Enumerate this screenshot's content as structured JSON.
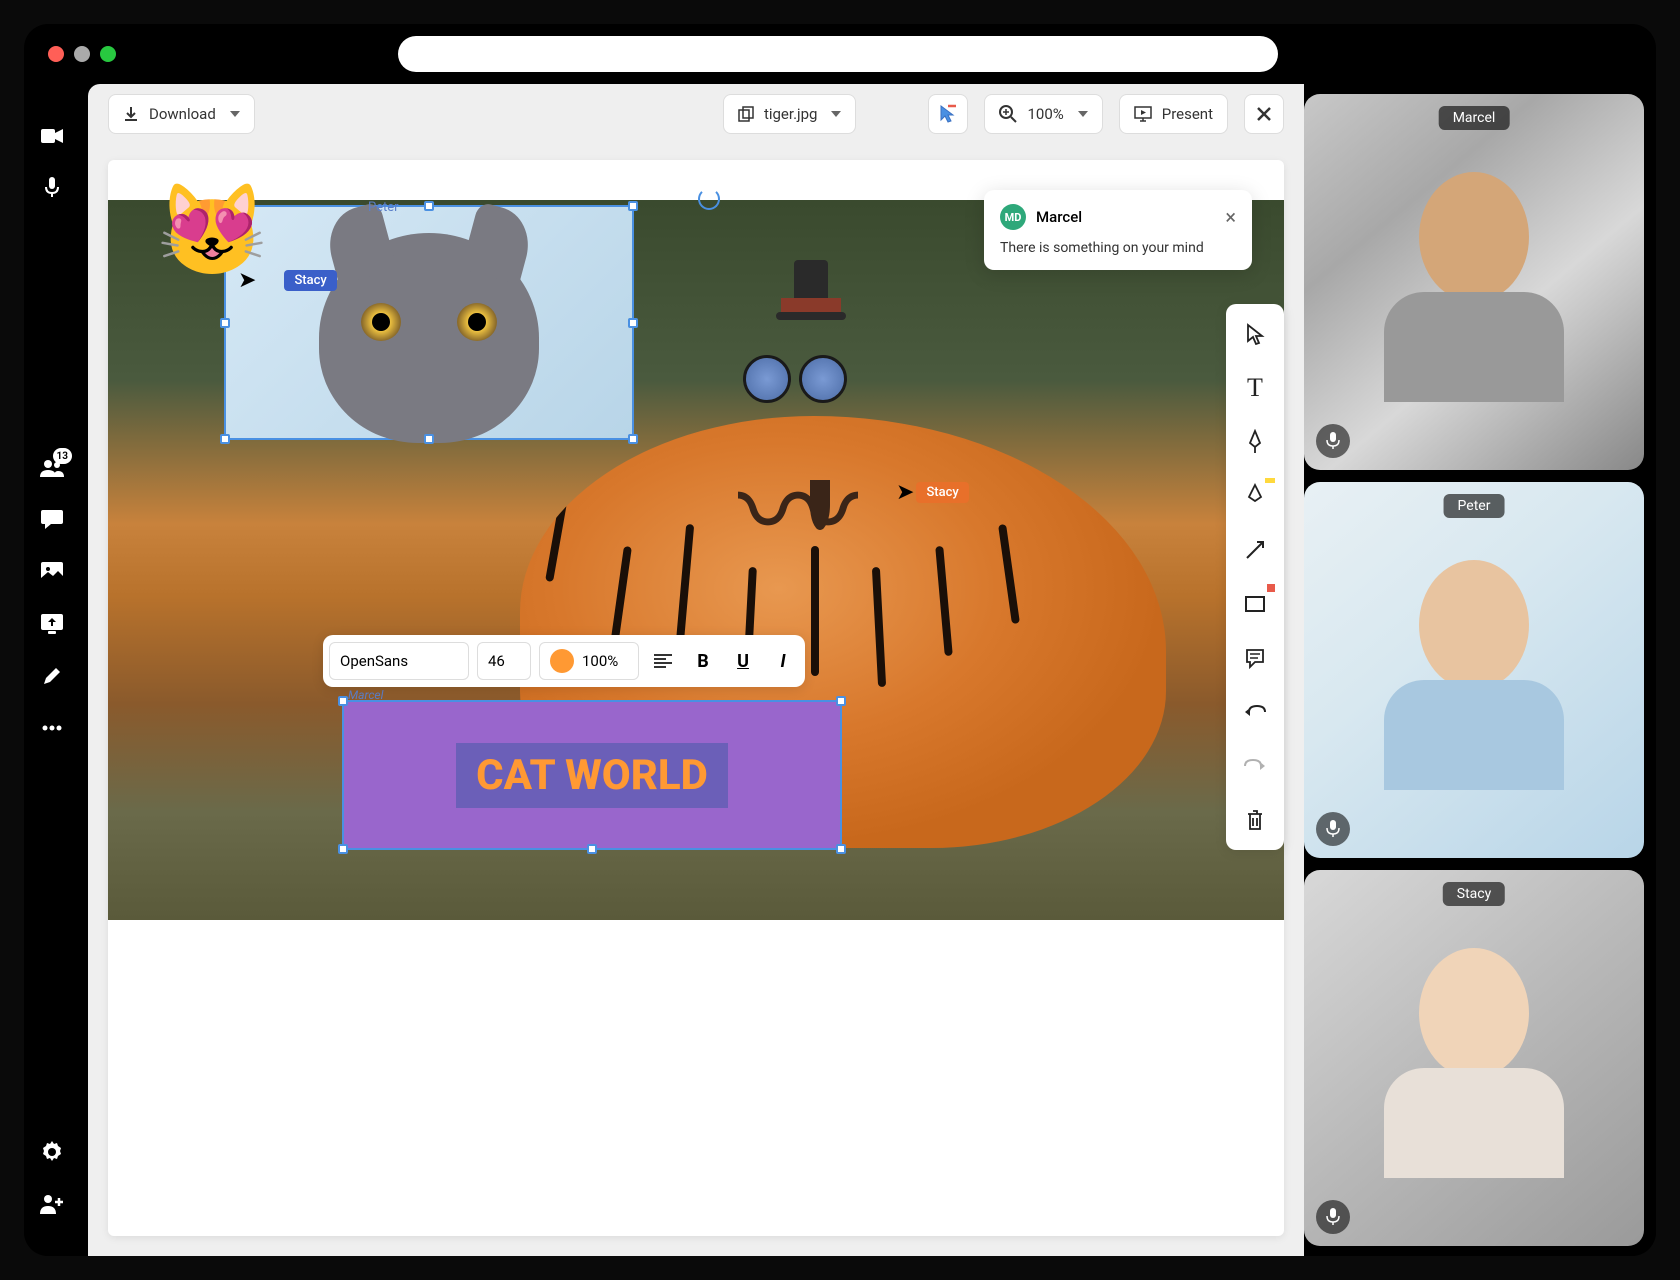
{
  "leftbar": {
    "badge_count": "13"
  },
  "toolbar": {
    "download_label": "Download",
    "filename": "tiger.jpg",
    "zoom": "100%",
    "present_label": "Present"
  },
  "cursors": {
    "peter": "Peter",
    "stacy1": "Stacy",
    "stacy2": "Stacy",
    "marcel_small": "Marcel"
  },
  "comment": {
    "avatar": "MD",
    "author": "Marcel",
    "message": "There is something on your mind"
  },
  "text_toolbar": {
    "font": "OpenSans",
    "size": "46",
    "opacity": "100%"
  },
  "canvas_text": "CAT WORLD",
  "videos": {
    "v1": "Marcel",
    "v2": "Peter",
    "v3": "Stacy"
  },
  "emoji": "😻"
}
